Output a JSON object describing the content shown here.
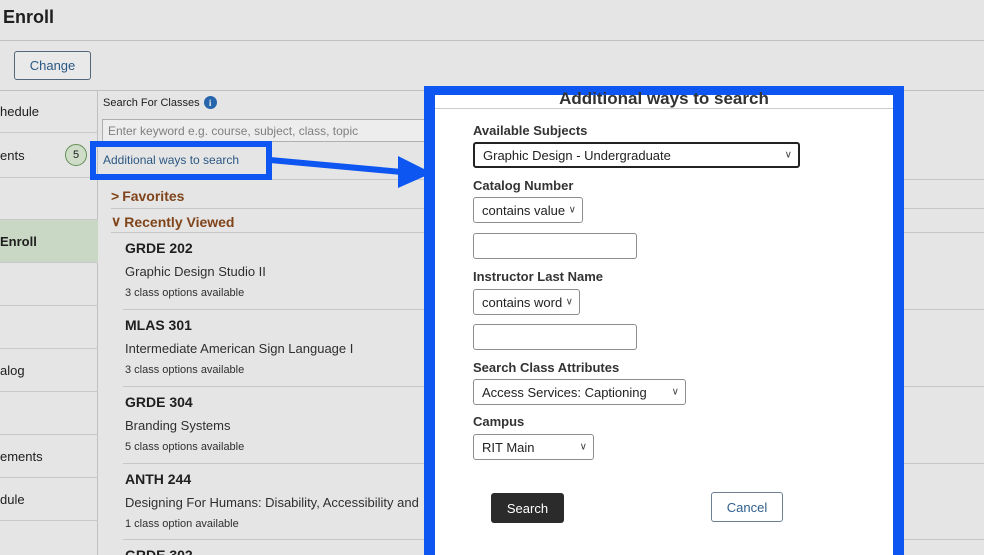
{
  "page": {
    "title": "Enroll",
    "change_label": "Change"
  },
  "sidebar": {
    "items": [
      {
        "label": "hedule"
      },
      {
        "label": "ents",
        "badge": "5"
      },
      {
        "label": ""
      },
      {
        "label": "Enroll"
      },
      {
        "label": ""
      },
      {
        "label": ""
      },
      {
        "label": "alog"
      },
      {
        "label": ""
      },
      {
        "label": "ements"
      },
      {
        "label": "dule"
      }
    ]
  },
  "search": {
    "label": "Search For Classes",
    "info_icon": "i",
    "placeholder": "Enter keyword e.g. course, subject, class, topic",
    "additional_link": "Additional ways to search"
  },
  "accordion": {
    "favorites": "Favorites",
    "recently_viewed": "Recently Viewed",
    "favorites_chevron": ">",
    "recent_chevron": "∨"
  },
  "courses": [
    {
      "code": "GRDE 202",
      "name": "Graphic Design Studio II",
      "options": "3 class options available"
    },
    {
      "code": "MLAS 301",
      "name": "Intermediate American Sign Language I",
      "options": "3 class options available"
    },
    {
      "code": "GRDE 304",
      "name": "Branding Systems",
      "options": "5 class options available"
    },
    {
      "code": "ANTH 244",
      "name": "Designing For Humans: Disability, Accessibility and",
      "options": "1 class option available"
    },
    {
      "code": "GRDE 302",
      "name": "",
      "options": ""
    }
  ],
  "modal": {
    "title": "Additional ways to search",
    "available_subjects_label": "Available Subjects",
    "available_subjects_value": "Graphic Design - Undergraduate",
    "catalog_number_label": "Catalog Number",
    "catalog_number_operator": "contains value",
    "catalog_number_value": "",
    "instructor_label": "Instructor Last Name",
    "instructor_operator": "contains word",
    "instructor_value": "",
    "attributes_label": "Search Class Attributes",
    "attributes_value": "Access Services: Captioning",
    "campus_label": "Campus",
    "campus_value": "RIT Main",
    "search_button": "Search",
    "cancel_button": "Cancel",
    "chevron": "∨"
  },
  "colors": {
    "highlight": "#0d56f2",
    "accent_link": "#2f5f8e",
    "active_sidebar": "#d9e9d3",
    "heading_brown": "#8a4a1c"
  }
}
